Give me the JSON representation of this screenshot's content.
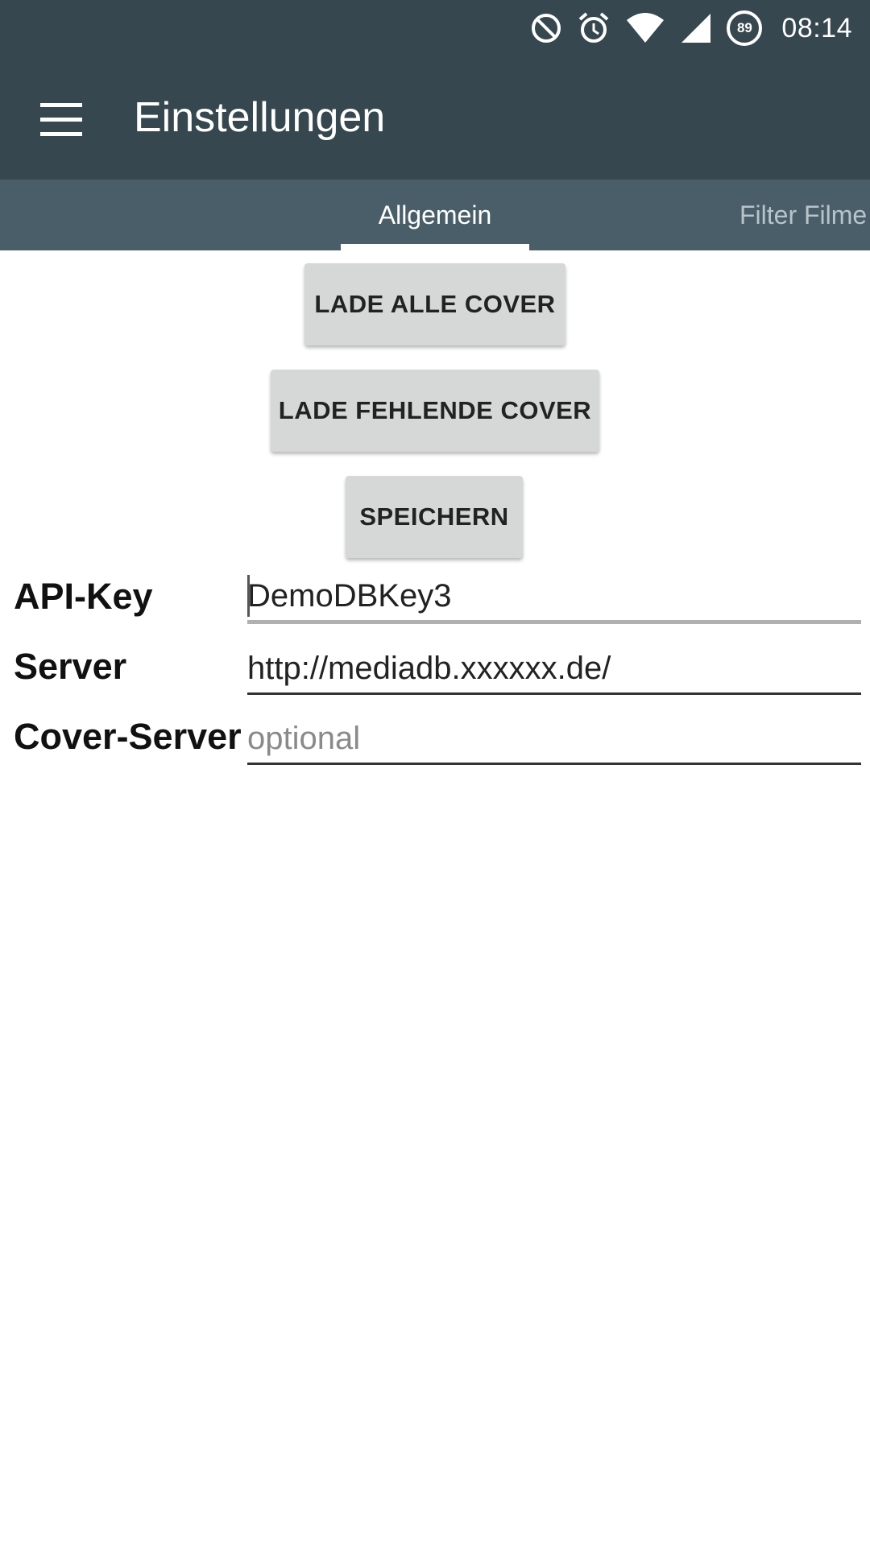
{
  "status_bar": {
    "time": "08:14",
    "battery_level": "89",
    "icons": [
      "do-not-disturb-icon",
      "alarm-icon",
      "wifi-icon",
      "cellular-signal-icon",
      "battery-icon"
    ]
  },
  "app_bar": {
    "title": "Einstellungen",
    "menu_icon": "hamburger-menu-icon",
    "background_color": "#37474f"
  },
  "tabs": [
    {
      "label": "Allgemein",
      "selected": true
    },
    {
      "label": "Filter Filme",
      "selected": false
    }
  ],
  "buttons": {
    "load_all_covers": "LADE ALLE COVER",
    "load_missing_covers": "LADE FEHLENDE COVER",
    "save": "SPEICHERN"
  },
  "fields": {
    "api_key": {
      "label": "API-Key",
      "value": "DemoDBKey3"
    },
    "server": {
      "label": "Server",
      "value": "http://mediadb.xxxxxx.de/"
    },
    "cover_server": {
      "label": "Cover-Server",
      "value": "",
      "placeholder": "optional"
    }
  }
}
